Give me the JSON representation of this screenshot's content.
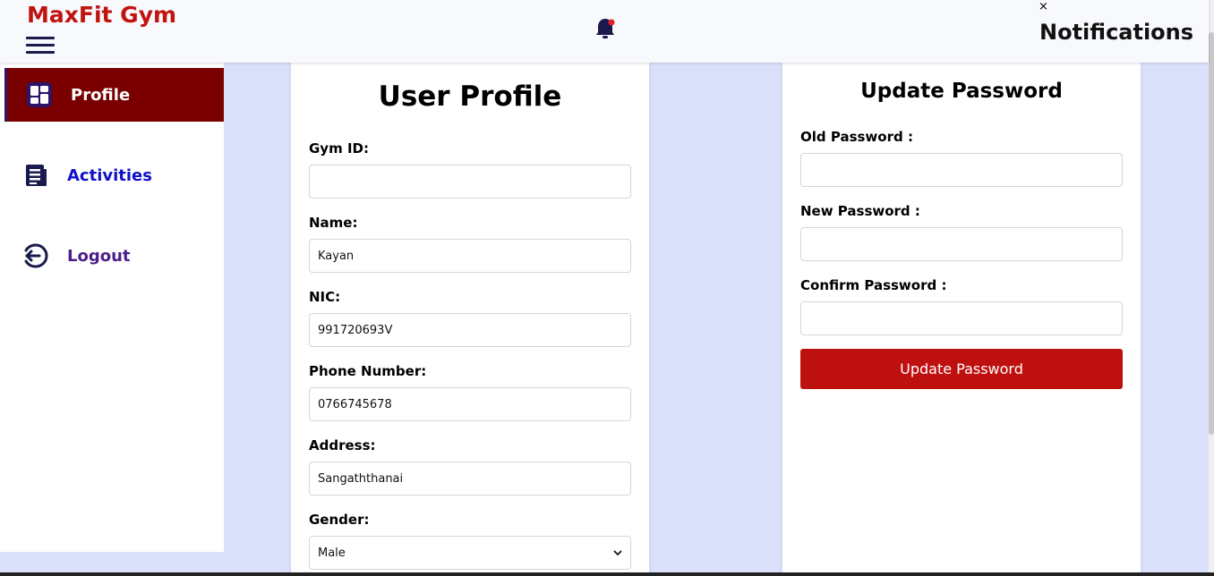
{
  "header": {
    "brand": "MaxFit Gym",
    "notifications_title": "Notifications",
    "close_symbol": "×"
  },
  "sidebar": {
    "items": [
      {
        "label": "Profile",
        "icon": "dashboard-icon",
        "active": true
      },
      {
        "label": "Activities",
        "icon": "document-list-icon",
        "active": false
      },
      {
        "label": "Logout",
        "icon": "logout-icon",
        "active": false
      }
    ]
  },
  "profile": {
    "title": "User Profile",
    "fields": {
      "gym_id": {
        "label": "Gym ID:",
        "value": ""
      },
      "name": {
        "label": "Name:",
        "value": "Kayan"
      },
      "nic": {
        "label": "NIC:",
        "value": "991720693V"
      },
      "phone": {
        "label": "Phone Number:",
        "value": "0766745678"
      },
      "address": {
        "label": "Address:",
        "value": "Sangaththanai"
      },
      "gender": {
        "label": "Gender:",
        "value": "Male"
      }
    }
  },
  "password": {
    "title": "Update Password",
    "old_label": "Old Password :",
    "new_label": "New Password :",
    "confirm_label": "Confirm Password :",
    "button_label": "Update Password"
  },
  "colors": {
    "brand": "#c0140f",
    "active_nav_bg": "#7a0000",
    "activities_text": "#1010c8",
    "logout_text": "#4b1f8a",
    "button_bg": "#bf1010",
    "page_bg": "#dbe1fb"
  }
}
